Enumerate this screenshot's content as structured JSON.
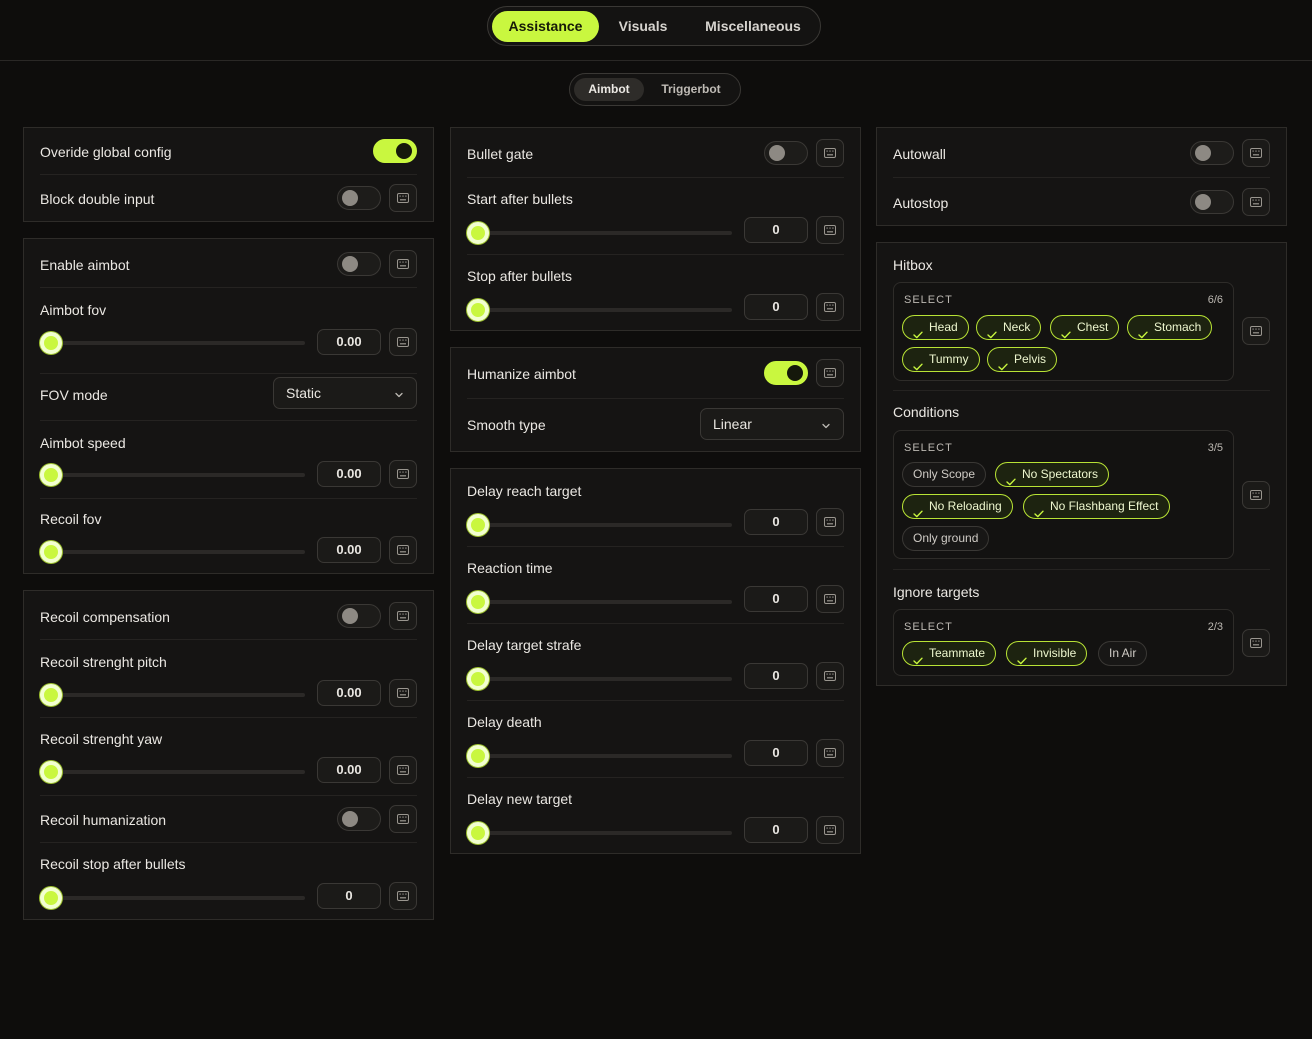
{
  "main_tabs": [
    "Assistance",
    "Visuals",
    "Miscellaneous"
  ],
  "sub_tabs": [
    "Aimbot",
    "Triggerbot"
  ],
  "col1": {
    "overide_global_config": {
      "label": "Overide global config",
      "on": true
    },
    "block_double_input": {
      "label": "Block double input",
      "on": false
    },
    "enable_aimbot": {
      "label": "Enable aimbot",
      "on": false
    },
    "aimbot_fov": {
      "label": "Aimbot fov",
      "value": "0.00"
    },
    "fov_mode": {
      "label": "FOV mode",
      "value": "Static"
    },
    "aimbot_speed": {
      "label": "Aimbot speed",
      "value": "0.00"
    },
    "recoil_fov": {
      "label": "Recoil fov",
      "value": "0.00"
    },
    "recoil_compensation": {
      "label": "Recoil compensation",
      "on": false
    },
    "recoil_strength_pitch": {
      "label": "Recoil strenght pitch",
      "value": "0.00"
    },
    "recoil_strength_yaw": {
      "label": "Recoil strenght yaw",
      "value": "0.00"
    },
    "recoil_humanization": {
      "label": "Recoil humanization",
      "on": false
    },
    "recoil_stop_after_bullets": {
      "label": "Recoil stop after bullets",
      "value": "0"
    }
  },
  "col2": {
    "bullet_gate": {
      "label": "Bullet gate",
      "on": false
    },
    "start_after_bullets": {
      "label": "Start after bullets",
      "value": "0"
    },
    "stop_after_bullets": {
      "label": "Stop after bullets",
      "value": "0"
    },
    "humanize_aimbot": {
      "label": "Humanize aimbot",
      "on": true
    },
    "smooth_type": {
      "label": "Smooth type",
      "value": "Linear"
    },
    "delay_reach_target": {
      "label": "Delay reach target",
      "value": "0"
    },
    "reaction_time": {
      "label": "Reaction time",
      "value": "0"
    },
    "delay_target_strafe": {
      "label": "Delay target strafe",
      "value": "0"
    },
    "delay_death": {
      "label": "Delay death",
      "value": "0"
    },
    "delay_new_target": {
      "label": "Delay new target",
      "value": "0"
    }
  },
  "col3": {
    "autowall": {
      "label": "Autowall",
      "on": false
    },
    "autostop": {
      "label": "Autostop",
      "on": false
    },
    "hitbox": {
      "title": "Hitbox",
      "select_label": "SELECT",
      "count": "6/6",
      "chips": [
        {
          "label": "Head",
          "on": true
        },
        {
          "label": "Neck",
          "on": true
        },
        {
          "label": "Chest",
          "on": true
        },
        {
          "label": "Stomach",
          "on": true
        },
        {
          "label": "Tummy",
          "on": true
        },
        {
          "label": "Pelvis",
          "on": true
        }
      ]
    },
    "conditions": {
      "title": "Conditions",
      "select_label": "SELECT",
      "count": "3/5",
      "chips": [
        {
          "label": "Only Scope",
          "on": false
        },
        {
          "label": "No Spectators",
          "on": true
        },
        {
          "label": "No Reloading",
          "on": true
        },
        {
          "label": "No Flashbang Effect",
          "on": true
        },
        {
          "label": "Only ground",
          "on": false
        }
      ]
    },
    "ignore_targets": {
      "title": "Ignore targets",
      "select_label": "SELECT",
      "count": "2/3",
      "chips": [
        {
          "label": "Teammate",
          "on": true
        },
        {
          "label": "Invisible",
          "on": true
        },
        {
          "label": "In Air",
          "on": false
        }
      ]
    }
  },
  "colors": {
    "accent": "#c9f73f",
    "background": "#0e0d0c",
    "panel": "#151413"
  },
  "icons": {
    "keybind": "keyboard-icon",
    "dropdown": "chevron-down-icon",
    "selected": "check-icon"
  }
}
